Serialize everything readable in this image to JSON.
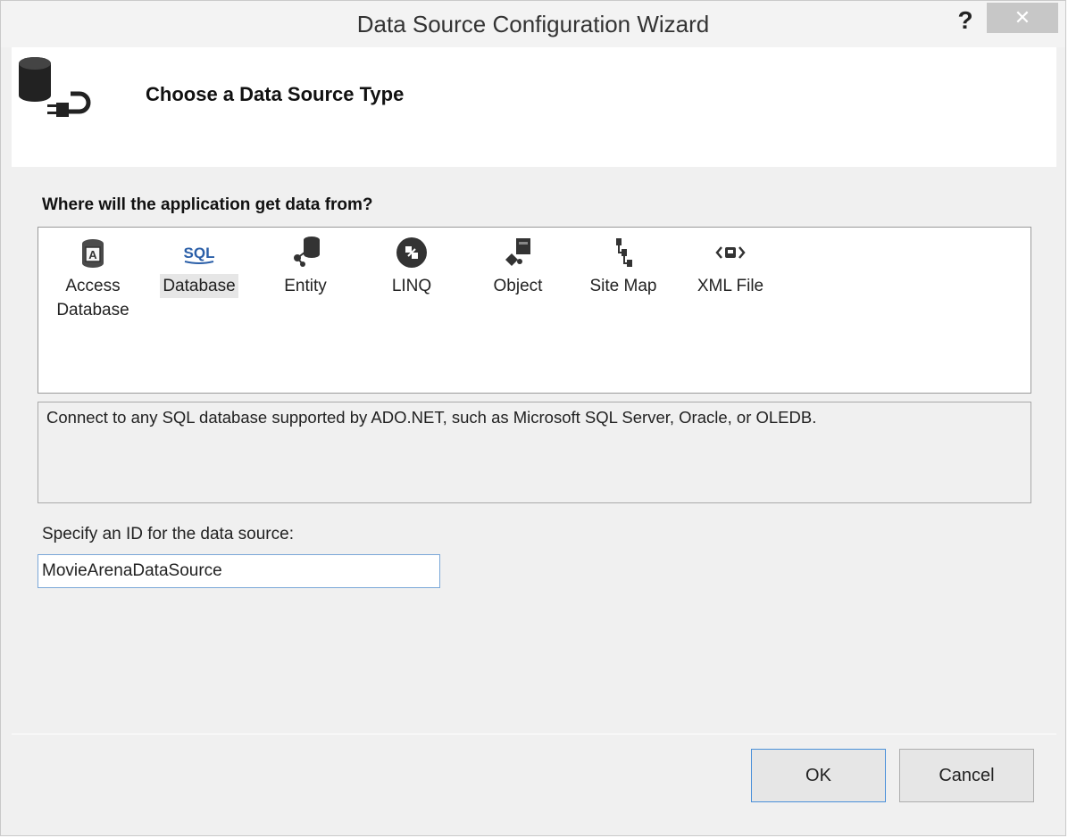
{
  "window": {
    "title": "Data Source Configuration Wizard",
    "help_glyph": "?",
    "close_glyph": "✕"
  },
  "header": {
    "title": "Choose a Data Source Type",
    "icon": "database-plug-icon"
  },
  "source_question": "Where will the application get data from?",
  "data_source_types": [
    {
      "label": "Access Database",
      "icon": "access-database-icon",
      "selected": false
    },
    {
      "label": "Database",
      "icon": "sql-database-icon",
      "icon_text": "SQL",
      "selected": true
    },
    {
      "label": "Entity",
      "icon": "entity-icon",
      "selected": false
    },
    {
      "label": "LINQ",
      "icon": "linq-icon",
      "selected": false
    },
    {
      "label": "Object",
      "icon": "object-icon",
      "selected": false
    },
    {
      "label": "Site Map",
      "icon": "site-map-icon",
      "selected": false
    },
    {
      "label": "XML File",
      "icon": "xml-file-icon",
      "selected": false
    }
  ],
  "description": "Connect to any SQL database supported by ADO.NET, such as Microsoft SQL Server, Oracle, or OLEDB.",
  "id_field": {
    "label": "Specify an ID for the data source:",
    "value": "MovieArenaDataSource"
  },
  "buttons": {
    "ok": "OK",
    "cancel": "Cancel"
  },
  "colors": {
    "sql_blue": "#2b5fa8",
    "icon_dark": "#3a3a3a",
    "focus_border": "#4a90d9"
  }
}
